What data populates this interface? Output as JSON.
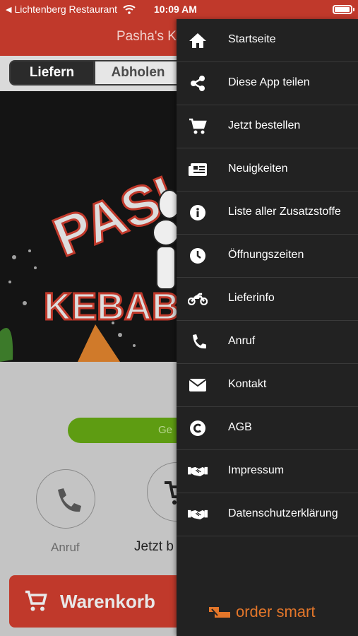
{
  "status": {
    "carrier": "Lichtenberg Restaurant",
    "time": "10:09 AM",
    "back_icon": "back-arrow-icon",
    "wifi_icon": "wifi-icon",
    "battery_icon": "battery-icon"
  },
  "app": {
    "title": "Pasha's K",
    "tabs": [
      "Liefern",
      "Abholen"
    ],
    "hero_text_top": "PASI",
    "hero_text_bottom": "KEBAB",
    "green_button": "Ge",
    "call_label": "Anruf",
    "order_label": "Jetzt b",
    "cart_label": "Warenkorb",
    "accent": "#c0392b",
    "green": "#5e9c12"
  },
  "drawer": {
    "background": "#222222",
    "items": [
      {
        "label": "Startseite",
        "icon": "home-icon"
      },
      {
        "label": "Diese App teilen",
        "icon": "share-icon"
      },
      {
        "label": "Jetzt bestellen",
        "icon": "cart-icon"
      },
      {
        "label": "Neuigkeiten",
        "icon": "news-icon"
      },
      {
        "label": "Liste aller Zusatzstoffe",
        "icon": "info-icon"
      },
      {
        "label": "Öffnungszeiten",
        "icon": "clock-icon"
      },
      {
        "label": "Lieferinfo",
        "icon": "motorcycle-icon"
      },
      {
        "label": "Anruf",
        "icon": "phone-icon"
      },
      {
        "label": "Kontakt",
        "icon": "mail-icon"
      },
      {
        "label": "AGB",
        "icon": "copyright-icon"
      },
      {
        "label": "Impressum",
        "icon": "handshake-icon"
      },
      {
        "label": "Datenschutzerklärung",
        "icon": "handshake-icon"
      }
    ],
    "brand": "order smart",
    "brand_color": "#e3762a"
  }
}
